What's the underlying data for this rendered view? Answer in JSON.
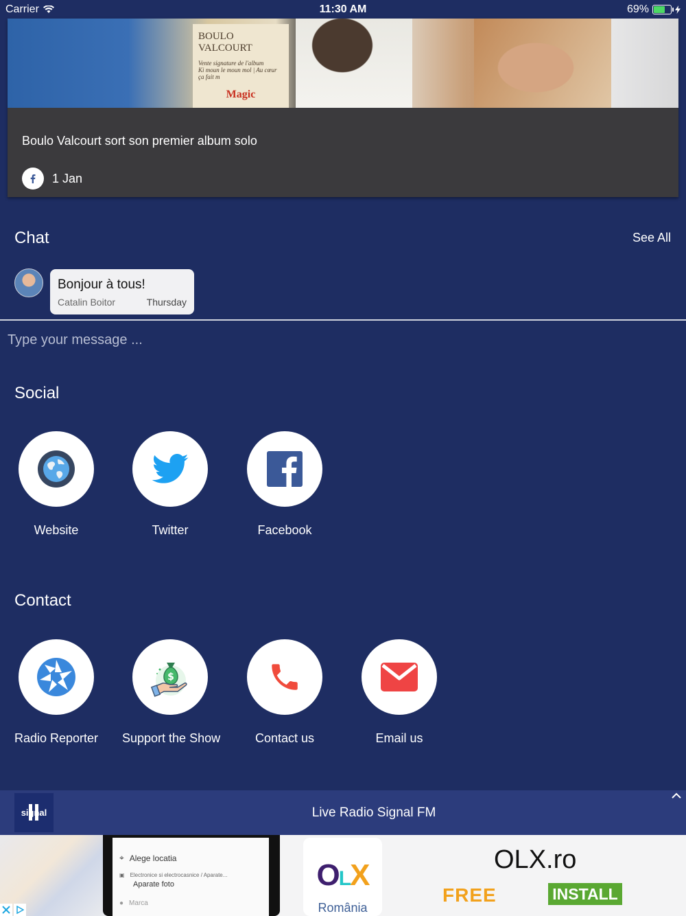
{
  "status_bar": {
    "carrier": "Carrier",
    "time": "11:30 AM",
    "battery": "69%",
    "battery_level": 0.69
  },
  "news": {
    "headline": "Boulo Valcourt sort son premier album solo",
    "date": "1 Jan",
    "photo_text": {
      "line1": "BOULO VALCOURT",
      "line2": "Vente signature de l'album",
      "line3": "Ki moun le moun mol | Au cœur ça fait m",
      "logo": "Magic"
    }
  },
  "chat": {
    "title": "Chat",
    "see_all": "See All",
    "message": {
      "text": "Bonjour à tous!",
      "author": "Catalin Boitor",
      "day": "Thursday"
    },
    "input_placeholder": "Type your message ..."
  },
  "social": {
    "title": "Social",
    "items": [
      {
        "label": "Website",
        "icon": "globe-icon"
      },
      {
        "label": "Twitter",
        "icon": "twitter-icon"
      },
      {
        "label": "Facebook",
        "icon": "facebook-icon"
      }
    ]
  },
  "contact": {
    "title": "Contact",
    "items": [
      {
        "label": "Radio Reporter",
        "icon": "camera-aperture-icon"
      },
      {
        "label": "Support the Show",
        "icon": "money-bag-icon"
      },
      {
        "label": "Contact us",
        "icon": "phone-icon"
      },
      {
        "label": "Email us",
        "icon": "envelope-icon"
      }
    ]
  },
  "player": {
    "title": "Live Radio Signal FM",
    "logo_text": "signal"
  },
  "ad": {
    "phone_rows": [
      "Alege locatia",
      "Electronice si electrocasnice / Aparate...",
      "Aparate foto",
      "Marca"
    ],
    "logo_o": "O",
    "logo_l": "L",
    "logo_x": "X",
    "country": "România",
    "brand": "OLX.ro",
    "free": "FREE",
    "install": "INSTALL"
  },
  "colors": {
    "background": "#1e2d62",
    "card": "#3b3a3d",
    "player_bar": "#2c3c7c",
    "facebook": "#3b5998",
    "twitter": "#1da1f2",
    "phone": "#f04b3c",
    "install": "#5aa832"
  }
}
